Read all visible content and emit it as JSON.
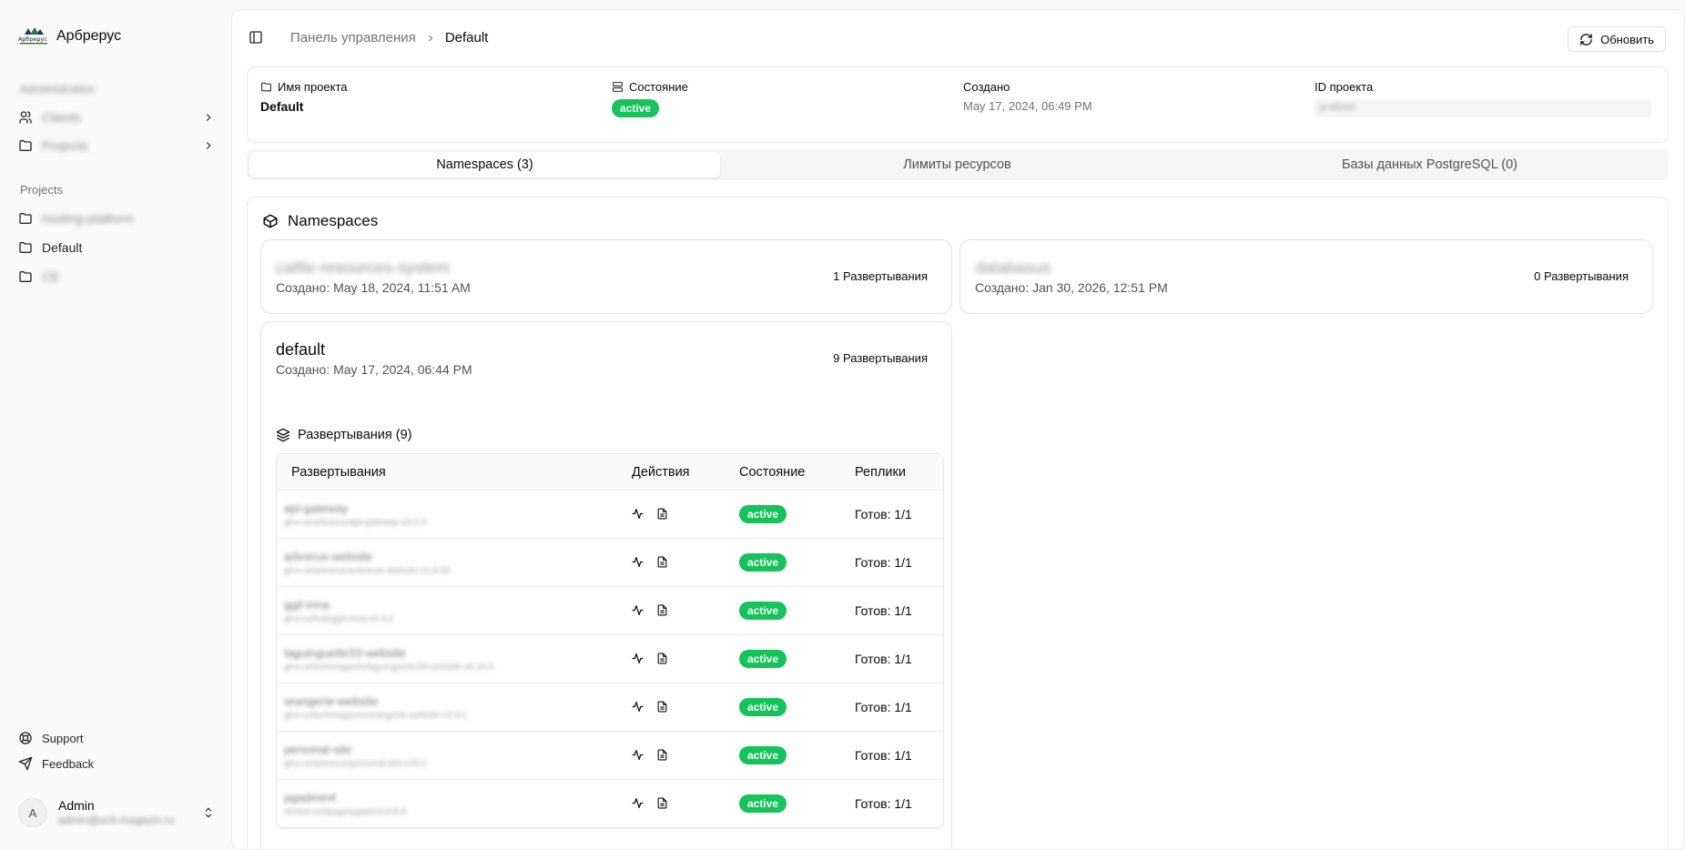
{
  "brand": {
    "name": "Арбрерус",
    "logo_text": "Арбрерус"
  },
  "sidebar": {
    "admin_label": "Administration",
    "admin_items": [
      {
        "label": "Clients",
        "icon": "users-icon"
      },
      {
        "label": "Projects",
        "icon": "folder-icon"
      }
    ],
    "projects_label": "Projects",
    "project_items": [
      {
        "label": "hosting-platform"
      },
      {
        "label": "Default"
      },
      {
        "label": "CE"
      }
    ],
    "support_label": "Support",
    "feedback_label": "Feedback",
    "user": {
      "initial": "A",
      "name": "Admin",
      "email": "admin@ech-magazin.ru"
    }
  },
  "topbar": {
    "breadcrumb_root": "Панель управления",
    "breadcrumb_current": "Default",
    "refresh_label": "Обновить"
  },
  "project": {
    "name_label": "Имя проекта",
    "name_value": "Default",
    "state_label": "Состояние",
    "state_value": "active",
    "created_label": "Создано",
    "created_value": "May 17, 2024, 06:49 PM",
    "id_label": "ID проекта",
    "id_value": "p-x8zc0"
  },
  "tabs": [
    {
      "label": "Namespaces (3)"
    },
    {
      "label": "Лимиты ресурсов"
    },
    {
      "label": "Базы данных PostgreSQL (0)"
    }
  ],
  "namespaces": {
    "title": "Namespaces",
    "cards": [
      {
        "name": "cattle-resources-system",
        "created": "Создано: May 18, 2024, 11:51 AM",
        "count": "1 Развертывания"
      },
      {
        "name": "databasus",
        "created": "Создано: Jan 30, 2026, 12:51 PM",
        "count": "0 Развертывания"
      },
      {
        "name": "default",
        "created": "Создано: May 17, 2024, 06:44 PM",
        "count": "9 Развертывания"
      }
    ]
  },
  "deployments": {
    "title": "Развертывания (9)",
    "columns": [
      "Развертывания",
      "Действия",
      "Состояние",
      "Реплики"
    ],
    "rows": [
      {
        "name": "api-gateway",
        "image": "ghcr.io/arbrerus/api-gateway:v0.2.0",
        "status": "active",
        "replicas": "Готов: 1/1"
      },
      {
        "name": "arbrerus-website",
        "image": "ghcr.io/arbrerus/arbrerus-website:v1.8.59",
        "status": "active",
        "replicas": "Готов: 1/1"
      },
      {
        "name": "ggit-inna",
        "image": "ghcr.io/fmb/ggit-inna:v0.3.2",
        "status": "active",
        "replicas": "Готов: 1/1"
      },
      {
        "name": "laguinguette33-website",
        "image": "ghcr.io/techmagazin/laguinguette33-website:v0.10.0",
        "status": "active",
        "replicas": "Готов: 1/1"
      },
      {
        "name": "orangerie-website",
        "image": "ghcr.io/techmagazin/orangerie-website:v2.3.1",
        "status": "active",
        "replicas": "Готов: 1/1"
      },
      {
        "name": "personal-site",
        "image": "ghcr.io/arbrerus/personal-site:v78.2",
        "status": "active",
        "replicas": "Готов: 1/1"
      },
      {
        "name": "pgadmin4",
        "image": "docker.io/dpage/pgadmin4:8.9",
        "status": "active",
        "replicas": "Готов: 1/1"
      }
    ]
  }
}
